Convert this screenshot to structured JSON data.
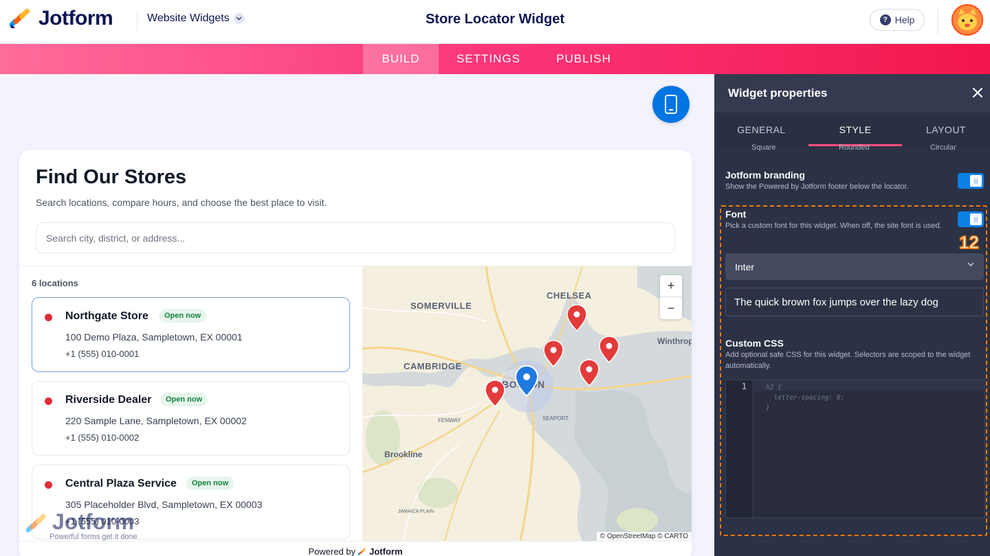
{
  "app": {
    "logo_text": "Jotform",
    "product_switcher": "Website Widgets",
    "page_title": "Store Locator Widget",
    "help_label": "Help"
  },
  "nav": {
    "tabs": [
      {
        "label": "BUILD",
        "active": true
      },
      {
        "label": "SETTINGS",
        "active": false
      },
      {
        "label": "PUBLISH",
        "active": false
      }
    ]
  },
  "widget": {
    "title": "Find Our Stores",
    "subtitle": "Search locations, compare hours, and choose the best place to visit.",
    "search_placeholder": "Search city, district, or address...",
    "locations_count": "6 locations",
    "stores": [
      {
        "name": "Northgate Store",
        "status": "Open now",
        "address": "100 Demo Plaza, Sampletown, EX 00001",
        "phone": "+1 (555) 010-0001",
        "selected": true
      },
      {
        "name": "Riverside Dealer",
        "status": "Open now",
        "address": "220 Sample Lane, Sampletown, EX 00002",
        "phone": "+1 (555) 010-0002",
        "selected": false
      },
      {
        "name": "Central Plaza Service",
        "status": "Open now",
        "address": "305 Placeholder Blvd, Sampletown, EX 00003",
        "phone": "+1 (555) 010-0003",
        "selected": false
      }
    ],
    "map": {
      "labels": [
        "SOMERVILLE",
        "CHELSEA",
        "CAMBRIDGE",
        "BOSTON",
        "Winthrop",
        "FENWAY",
        "SEAPORT",
        "Brookline",
        "JAMAICA PLAIN"
      ],
      "zoom_in": "+",
      "zoom_out": "−",
      "attribution": "© OpenStreetMap © CARTO"
    },
    "powered_by": "Powered by",
    "powered_brand": "Jotform"
  },
  "watermark": {
    "text": "Jotform",
    "tagline": "Powerful forms get it done"
  },
  "panel": {
    "title": "Widget properties",
    "tabs": [
      {
        "label": "GENERAL",
        "active": false
      },
      {
        "label": "STYLE",
        "active": true
      },
      {
        "label": "LAYOUT",
        "active": false
      }
    ],
    "shape_options": [
      "Square",
      "Rounded",
      "Circular"
    ],
    "branding": {
      "title": "Jotform branding",
      "description": "Show the Powered by Jotform footer below the locator.",
      "enabled": true
    },
    "font": {
      "title": "Font",
      "description": "Pick a custom font for this widget. When off, the site font is used.",
      "enabled": true,
      "selected": "Inter",
      "preview": "The quick brown fox jumps over the lazy dog"
    },
    "custom_css": {
      "title": "Custom CSS",
      "description": "Add optional safe CSS for this widget. Selectors are scoped to the widget automatically.",
      "line_number": "1",
      "code_placeholder": "h2 {\n  letter-spacing: 0;\n}"
    },
    "annotation_number": "12"
  },
  "colors": {
    "brand_navy": "#0a1551",
    "nav_gradient_start": "#ff6c9a",
    "nav_gradient_end": "#f2174d",
    "panel_bg": "#2b3245",
    "accent_blue": "#0075e3",
    "pin_red": "#e02f3a",
    "highlight_orange": "#ff7a00"
  }
}
